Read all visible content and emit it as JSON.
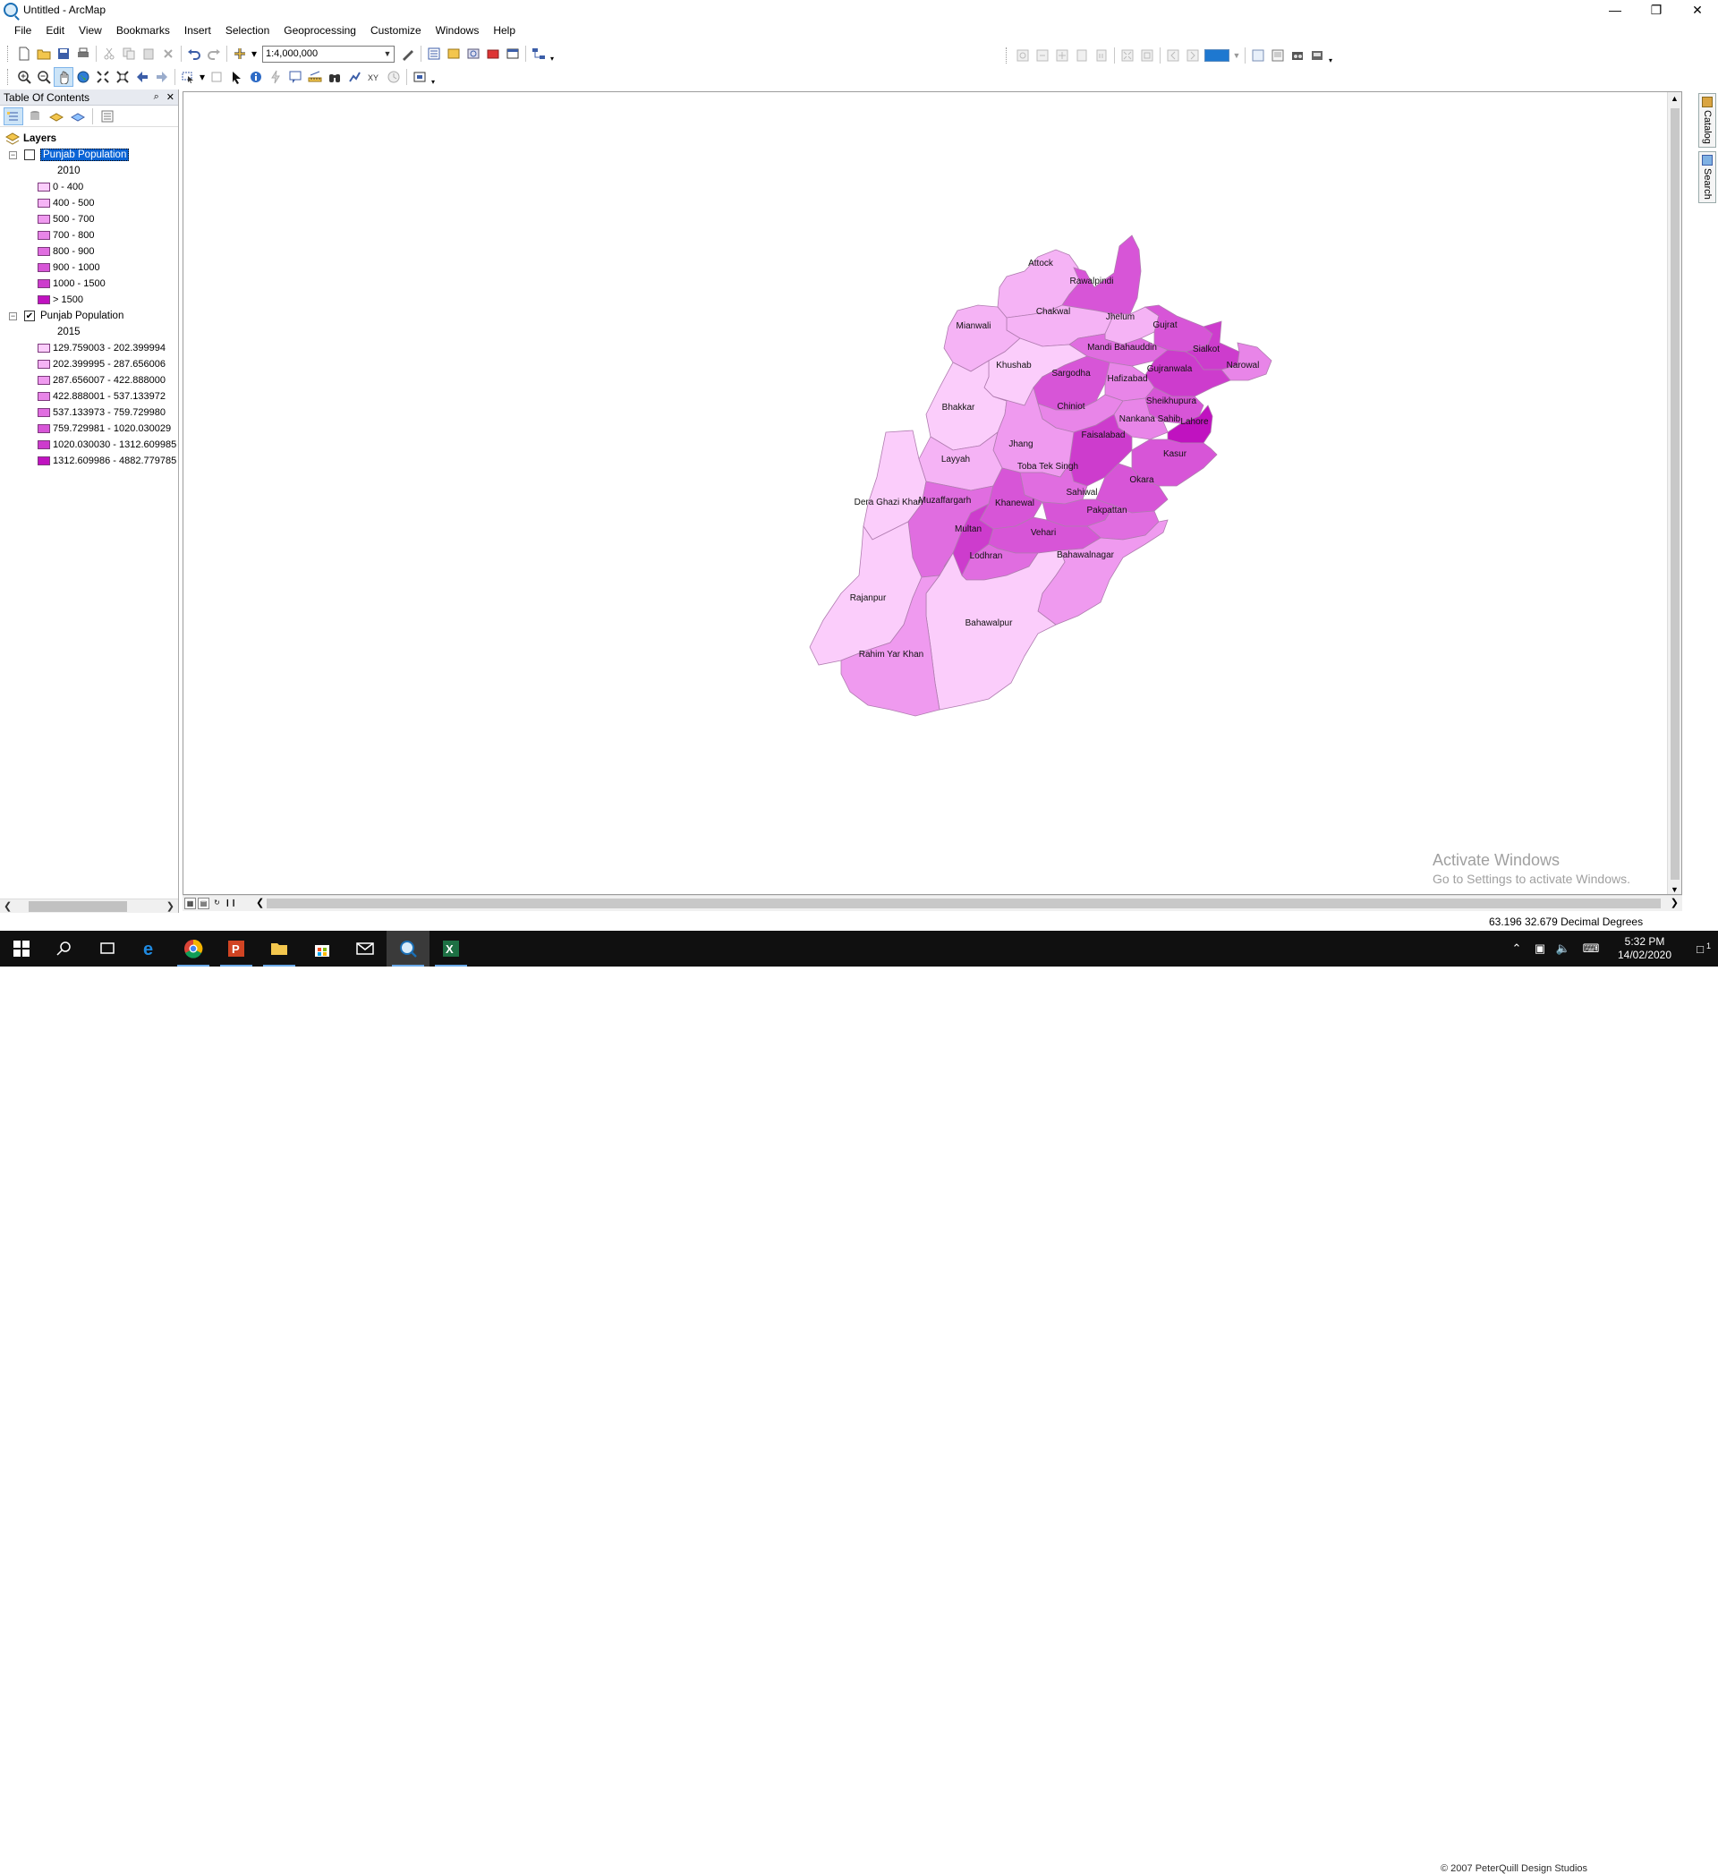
{
  "window": {
    "title": "Untitled - ArcMap",
    "buttons": [
      "minimize",
      "restore",
      "close"
    ]
  },
  "menu": [
    "File",
    "Edit",
    "View",
    "Bookmarks",
    "Insert",
    "Selection",
    "Geoprocessing",
    "Customize",
    "Windows",
    "Help"
  ],
  "toolbar": {
    "scale": "1:4,000,000",
    "accent_color": "#1e78d0"
  },
  "toc": {
    "title": "Table Of Contents",
    "root": "Layers",
    "layers": [
      {
        "name": "Punjab Population",
        "field": "2010",
        "checked": false,
        "selected": true,
        "classes": [
          {
            "label": "0 - 400",
            "color": "#fbcdfb"
          },
          {
            "label": "400 - 500",
            "color": "#f5b3f5"
          },
          {
            "label": "500 - 700",
            "color": "#ef9aef"
          },
          {
            "label": "700 - 800",
            "color": "#e885e8"
          },
          {
            "label": "800 - 900",
            "color": "#e06de0"
          },
          {
            "label": "900 - 1000",
            "color": "#d755d7"
          },
          {
            "label": "1000 - 1500",
            "color": "#cd3ccd"
          },
          {
            "label": "> 1500",
            "color": "#c012c0"
          }
        ]
      },
      {
        "name": "Punjab Population",
        "field": "2015",
        "checked": true,
        "selected": false,
        "classes": [
          {
            "label": "129.759003 - 202.399994",
            "color": "#fbcdfb"
          },
          {
            "label": "202.399995 - 287.656006",
            "color": "#f5b3f5"
          },
          {
            "label": "287.656007 - 422.888000",
            "color": "#ef9aef"
          },
          {
            "label": "422.888001 - 537.133972",
            "color": "#e885e8"
          },
          {
            "label": "537.133973 - 759.729980",
            "color": "#e06de0"
          },
          {
            "label": "759.729981 - 1020.030029",
            "color": "#d755d7"
          },
          {
            "label": "1020.030030 - 1312.609985",
            "color": "#cd3ccd"
          },
          {
            "label": "1312.609986 - 4882.779785",
            "color": "#c012c0"
          }
        ]
      }
    ]
  },
  "map": {
    "districts": [
      {
        "name": "Attock",
        "color": "#f5b3f5"
      },
      {
        "name": "Rawalpindi",
        "color": "#d755d7"
      },
      {
        "name": "Chakwal",
        "color": "#f5b3f5"
      },
      {
        "name": "Jhelum",
        "color": "#f5b3f5"
      },
      {
        "name": "Mianwali",
        "color": "#f5b3f5"
      },
      {
        "name": "Gujrat",
        "color": "#d755d7"
      },
      {
        "name": "Sialkot",
        "color": "#cd3ccd"
      },
      {
        "name": "Narowal",
        "color": "#e885e8"
      },
      {
        "name": "Mandi Bahauddin",
        "color": "#e06de0"
      },
      {
        "name": "Gujranwala",
        "color": "#cd3ccd"
      },
      {
        "name": "Khushab",
        "color": "#fbcdfb"
      },
      {
        "name": "Sargodha",
        "color": "#d755d7"
      },
      {
        "name": "Hafizabad",
        "color": "#e885e8"
      },
      {
        "name": "Sheikhupura",
        "color": "#d755d7"
      },
      {
        "name": "Bhakkar",
        "color": "#fbcdfb"
      },
      {
        "name": "Chiniot",
        "color": "#e885e8"
      },
      {
        "name": "Nankana Sahib",
        "color": "#e885e8"
      },
      {
        "name": "Lahore",
        "color": "#c012c0"
      },
      {
        "name": "Faisalabad",
        "color": "#cd3ccd"
      },
      {
        "name": "Jhang",
        "color": "#ef9aef"
      },
      {
        "name": "Layyah",
        "color": "#f5b3f5"
      },
      {
        "name": "Toba Tek Singh",
        "color": "#e06de0"
      },
      {
        "name": "Kasur",
        "color": "#d755d7"
      },
      {
        "name": "Okara",
        "color": "#d755d7"
      },
      {
        "name": "Dera Ghazi Khan",
        "color": "#fbcdfb"
      },
      {
        "name": "Muzaffargarh",
        "color": "#e06de0"
      },
      {
        "name": "Khanewal",
        "color": "#d755d7"
      },
      {
        "name": "Sahiwal",
        "color": "#d755d7"
      },
      {
        "name": "Pakpattan",
        "color": "#e06de0"
      },
      {
        "name": "Multan",
        "color": "#cd3ccd"
      },
      {
        "name": "Vehari",
        "color": "#d755d7"
      },
      {
        "name": "Lodhran",
        "color": "#e06de0"
      },
      {
        "name": "Bahawalnagar",
        "color": "#ef9aef"
      },
      {
        "name": "Rajanpur",
        "color": "#fbcdfb"
      },
      {
        "name": "Bahawalpur",
        "color": "#fbcdfb"
      },
      {
        "name": "Rahim Yar Khan",
        "color": "#ef9aef"
      }
    ],
    "watermark_line1": "Activate Windows",
    "watermark_line2": "Go to Settings to activate Windows."
  },
  "dock": {
    "tab1": "Catalog",
    "tab2": "Search"
  },
  "status": {
    "coords": "63.196  32.679 Decimal Degrees"
  },
  "taskbar": {
    "time": "5:32 PM",
    "date": "14/02/2020",
    "notification_count": "1",
    "background_text": "© 2007 PeterQuill Design Studios"
  }
}
